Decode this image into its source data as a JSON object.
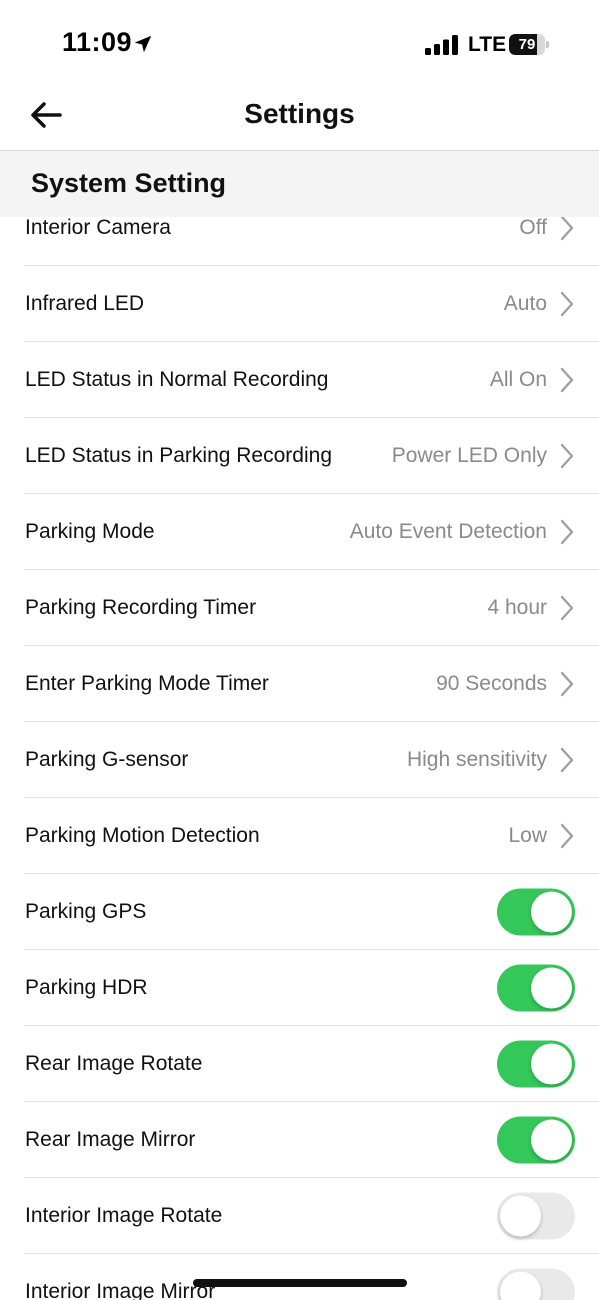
{
  "status_bar": {
    "time": "11:09",
    "location_icon": "location-arrow-icon",
    "signal_icon": "cellular-signal-icon",
    "network": "LTE",
    "battery_level": "79",
    "battery_fraction": 0.79
  },
  "header": {
    "back_icon": "arrow-left-icon",
    "title": "Settings"
  },
  "section": {
    "title": "System Setting"
  },
  "colors": {
    "toggle_on": "#34c759",
    "toggle_off": "#e9e9ea",
    "value_text": "#8a8a8a",
    "section_bg": "#f4f4f4"
  },
  "rows": [
    {
      "label": "Interior Camera",
      "type": "select",
      "value": "Off"
    },
    {
      "label": "Infrared LED",
      "type": "select",
      "value": "Auto"
    },
    {
      "label": "LED Status in Normal Recording",
      "type": "select",
      "value": "All On"
    },
    {
      "label": "LED Status in Parking Recording",
      "type": "select",
      "value": "Power LED Only"
    },
    {
      "label": "Parking Mode",
      "type": "select",
      "value": "Auto Event Detection"
    },
    {
      "label": "Parking Recording Timer",
      "type": "select",
      "value": "4 hour"
    },
    {
      "label": "Enter Parking Mode Timer",
      "type": "select",
      "value": "90 Seconds"
    },
    {
      "label": "Parking G-sensor",
      "type": "select",
      "value": "High sensitivity"
    },
    {
      "label": "Parking Motion Detection",
      "type": "select",
      "value": "Low"
    },
    {
      "label": "Parking GPS",
      "type": "toggle",
      "on": true
    },
    {
      "label": "Parking HDR",
      "type": "toggle",
      "on": true
    },
    {
      "label": "Rear Image Rotate",
      "type": "toggle",
      "on": true
    },
    {
      "label": "Rear Image Mirror",
      "type": "toggle",
      "on": true
    },
    {
      "label": "Interior Image Rotate",
      "type": "toggle",
      "on": false
    },
    {
      "label": "Interior Image Mirror",
      "type": "toggle",
      "on": false
    }
  ]
}
